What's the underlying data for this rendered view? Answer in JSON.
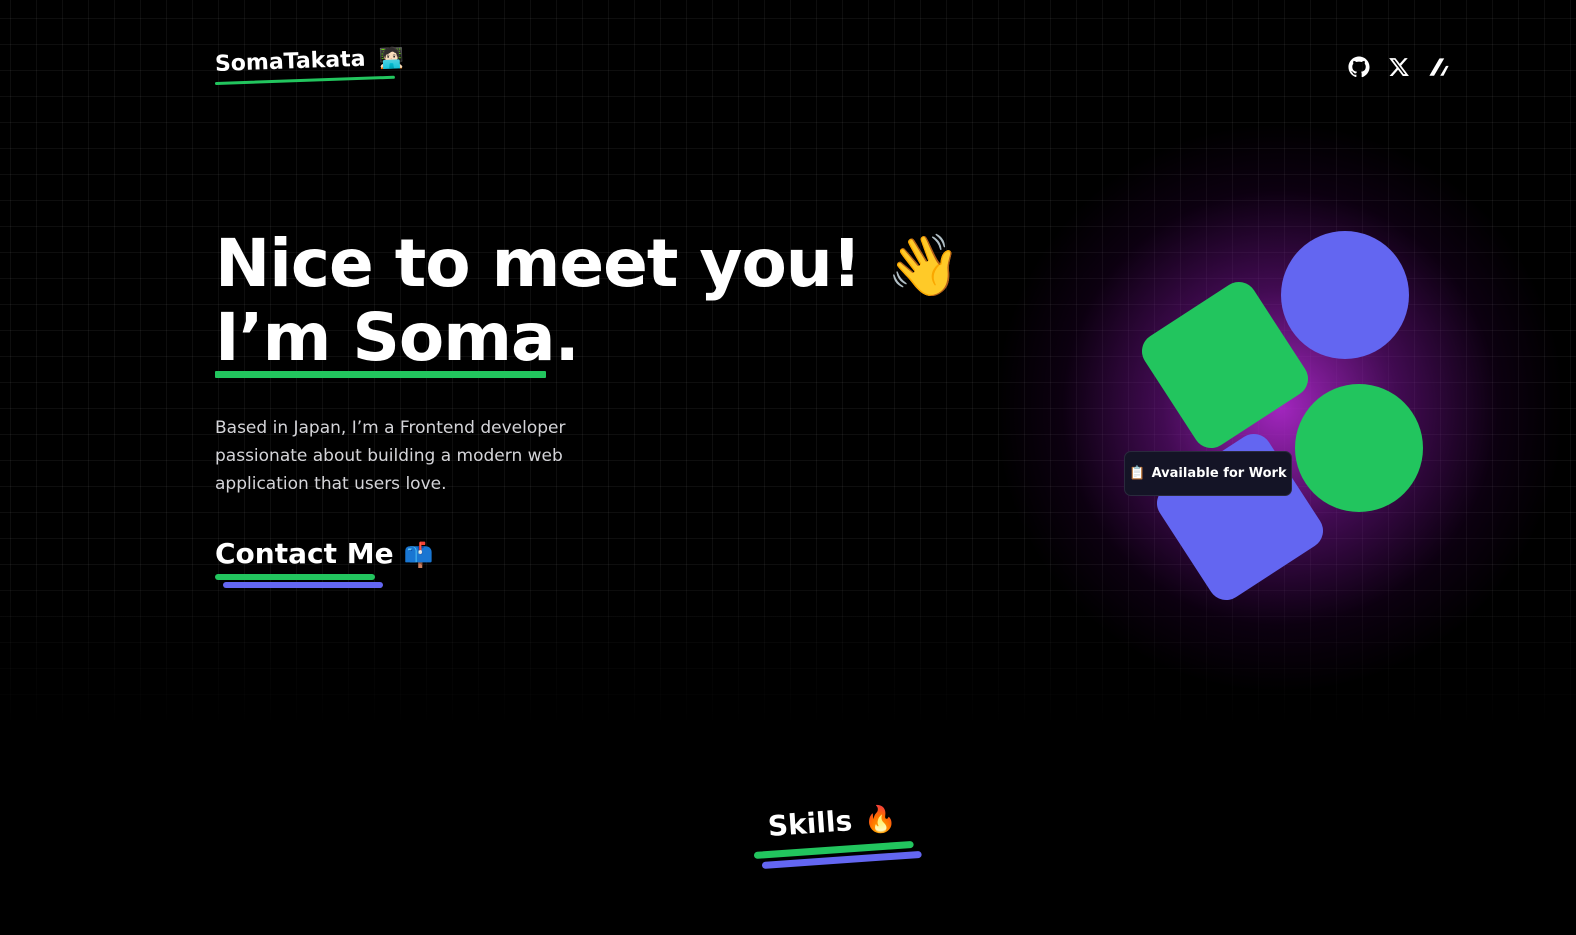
{
  "header": {
    "logo_text": "SomaTakata",
    "logo_emoji": "🧑🏻‍💻",
    "social_links": [
      {
        "icon": "github-icon",
        "label": "GitHub"
      },
      {
        "icon": "x-icon",
        "label": "X"
      },
      {
        "icon": "zenn-icon",
        "label": "Zenn"
      }
    ]
  },
  "hero": {
    "headline_line1": "Nice to meet you!",
    "headline_emoji": "👋",
    "headline_line2": "I’m Soma.",
    "bio": "Based in Japan, I’m a Frontend developer passionate about building a modern web application that users love.",
    "contact_label": "Contact Me",
    "contact_emoji": "📫"
  },
  "badge": {
    "emoji": "📋",
    "label": "Available for Work"
  },
  "skills": {
    "title": "Skills",
    "emoji": "🔥"
  },
  "colors": {
    "background": "#000000",
    "accent_green": "#22c55e",
    "accent_indigo": "#6366f1",
    "glow_purple": "#aa28c8"
  }
}
